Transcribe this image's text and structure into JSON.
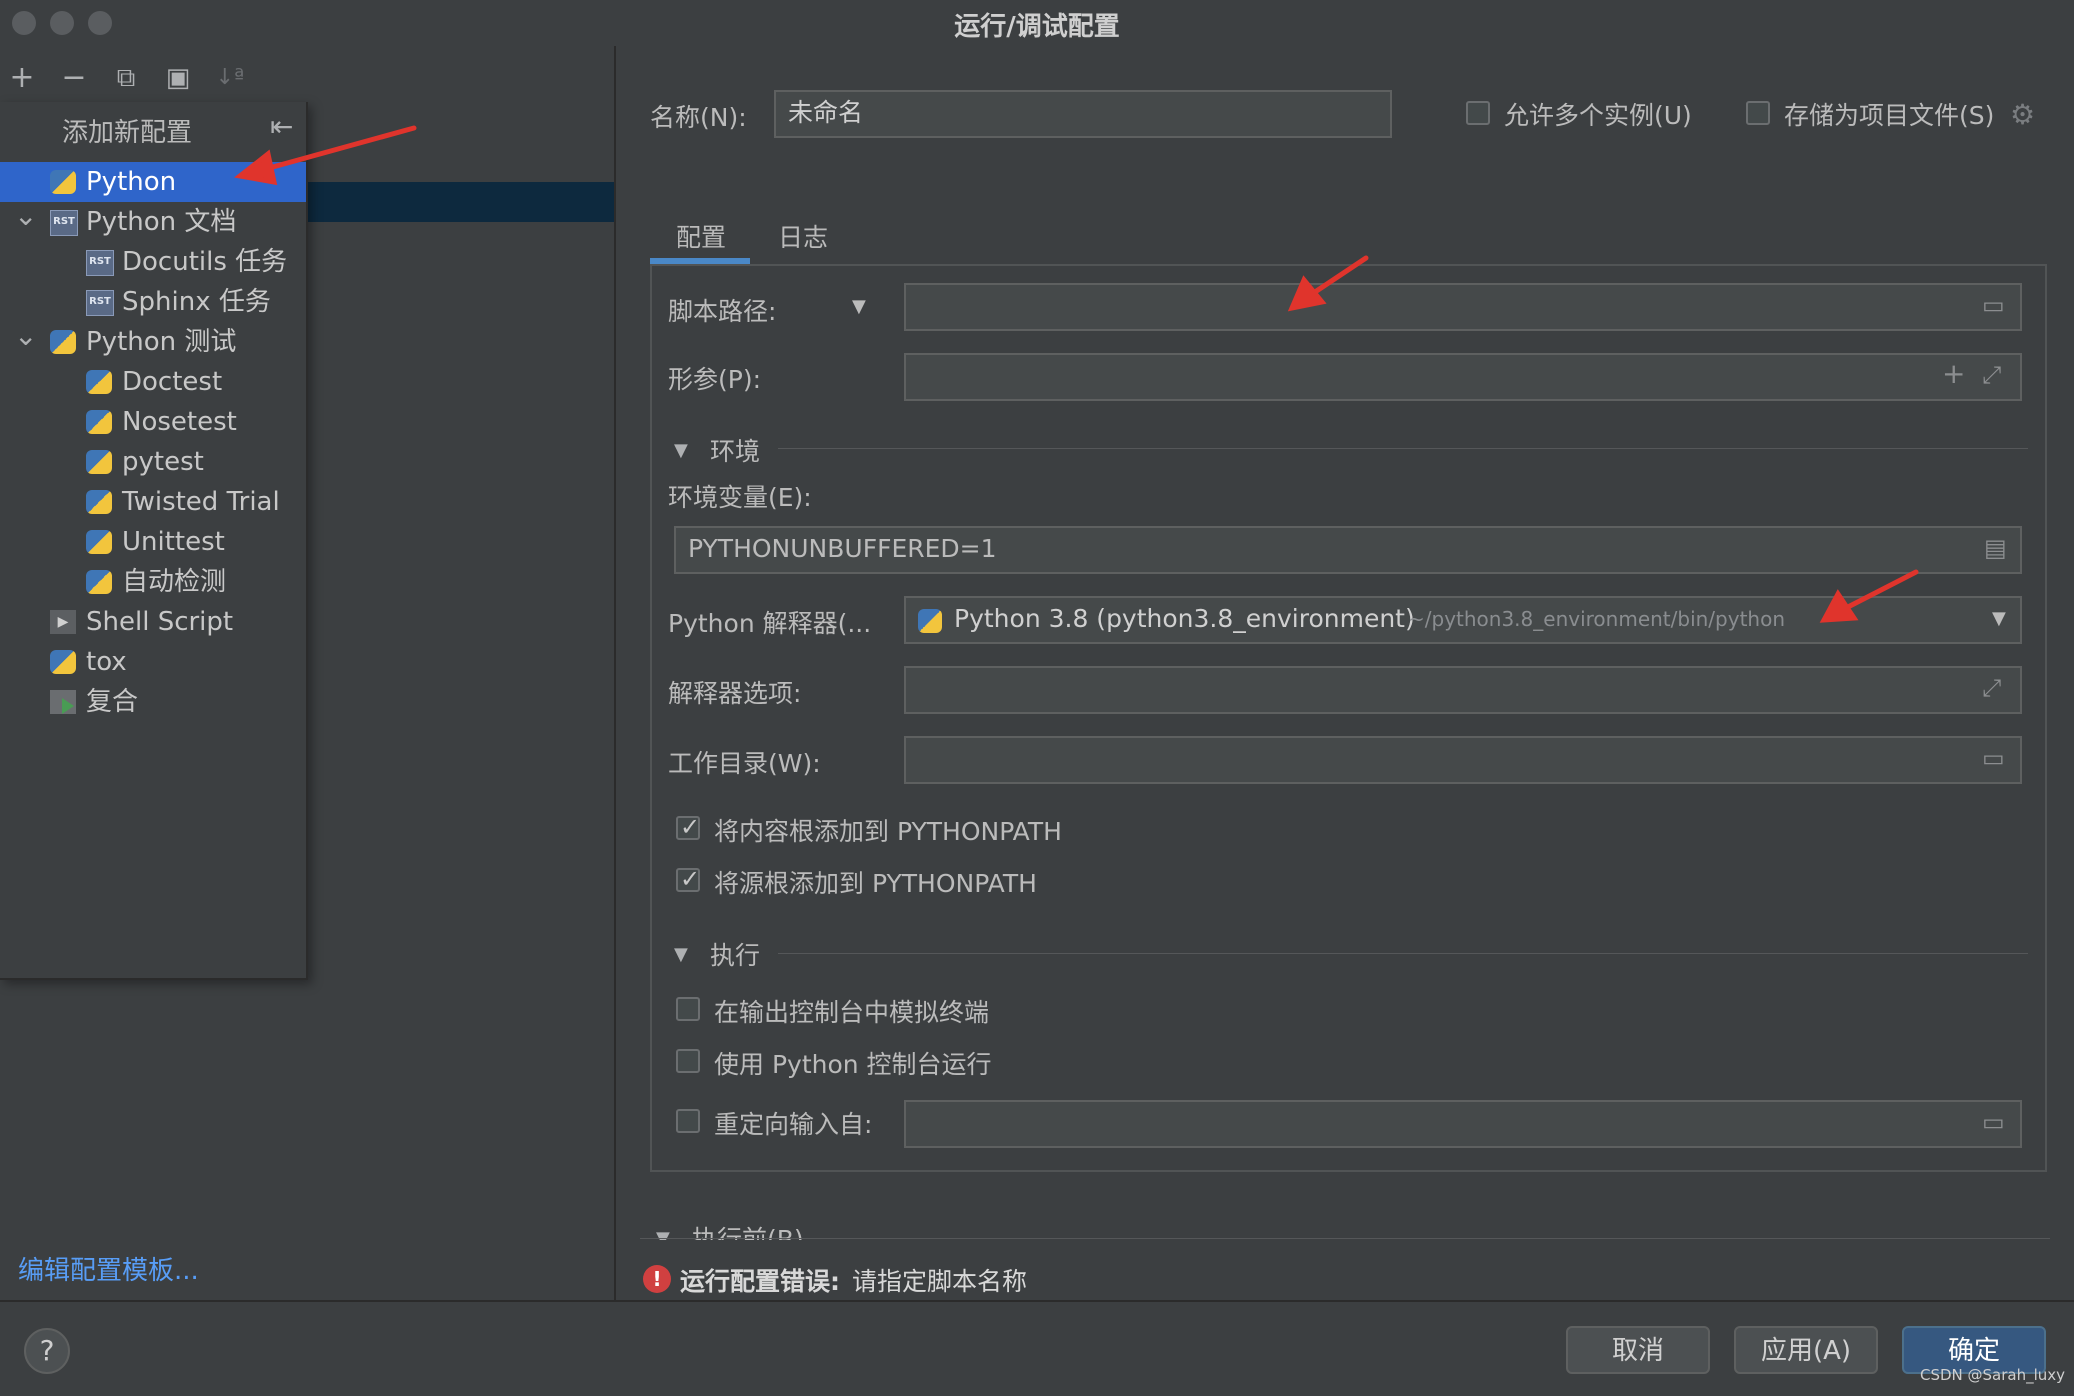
{
  "window": {
    "title": "运行/调试配置"
  },
  "toolbar": {
    "add": "+",
    "remove": "−",
    "copy": "⧉",
    "folder": "▣",
    "sort": "↓ª"
  },
  "popup": {
    "title": "添加新配置",
    "items": [
      {
        "label": "Python",
        "icon": "python-icon",
        "selected": true
      },
      {
        "label": "Python 文档",
        "icon": "rst-icon",
        "expanded": true
      },
      {
        "label": "Docutils 任务",
        "icon": "rst-icon"
      },
      {
        "label": "Sphinx 任务",
        "icon": "rst-icon"
      },
      {
        "label": "Python 测试",
        "icon": "python-test-icon",
        "expanded": true
      },
      {
        "label": "Doctest",
        "icon": "python-test-icon"
      },
      {
        "label": "Nosetest",
        "icon": "python-test-icon"
      },
      {
        "label": "pytest",
        "icon": "python-test-icon"
      },
      {
        "label": "Twisted Trial",
        "icon": "python-test-icon"
      },
      {
        "label": "Unittest",
        "icon": "python-test-icon"
      },
      {
        "label": "自动检测",
        "icon": "python-test-icon"
      },
      {
        "label": "Shell Script",
        "icon": "shell-icon"
      },
      {
        "label": "tox",
        "icon": "python-icon"
      },
      {
        "label": "复合",
        "icon": "compound-icon"
      }
    ],
    "rst_badge": "RST"
  },
  "left": {
    "edit_templates": "编辑配置模板..."
  },
  "form": {
    "name_label": "名称(N):",
    "name_value": "未命名",
    "allow_multiple": "允许多个实例(U)",
    "store_as_project": "存储为项目文件(S)",
    "tabs": [
      "配置",
      "日志"
    ],
    "script_path_label": "脚本路径:",
    "params_label": "形参(P):",
    "env_section": "环境",
    "env_vars_label": "环境变量(E):",
    "env_vars_value": "PYTHONUNBUFFERED=1",
    "interpreter_label": "Python 解释器(...",
    "interpreter_value": "Python 3.8 (python3.8_environment)",
    "interpreter_path": "~/python3.8_environment/bin/python",
    "interp_options_label": "解释器选项:",
    "workdir_label": "工作目录(W):",
    "add_content_roots": "将内容根添加到 PYTHONPATH",
    "add_source_roots": "将源根添加到 PYTHONPATH",
    "exec_section": "执行",
    "emulate_terminal": "在输出控制台中模拟终端",
    "run_with_console": "使用 Python 控制台运行",
    "redirect_input": "重定向输入自:",
    "before_launch": "执行前(B)",
    "error_prefix": "运行配置错误:",
    "error_message": "请指定脚本名称"
  },
  "buttons": {
    "cancel": "取消",
    "apply": "应用(A)",
    "ok": "确定",
    "help": "?"
  },
  "watermark": "CSDN @Sarah_luxy",
  "colors": {
    "background": "#3c3f41",
    "selection": "#2f65ca",
    "link": "#589df6",
    "primary_button": "#365880",
    "annotation_arrow": "#e0342c"
  }
}
